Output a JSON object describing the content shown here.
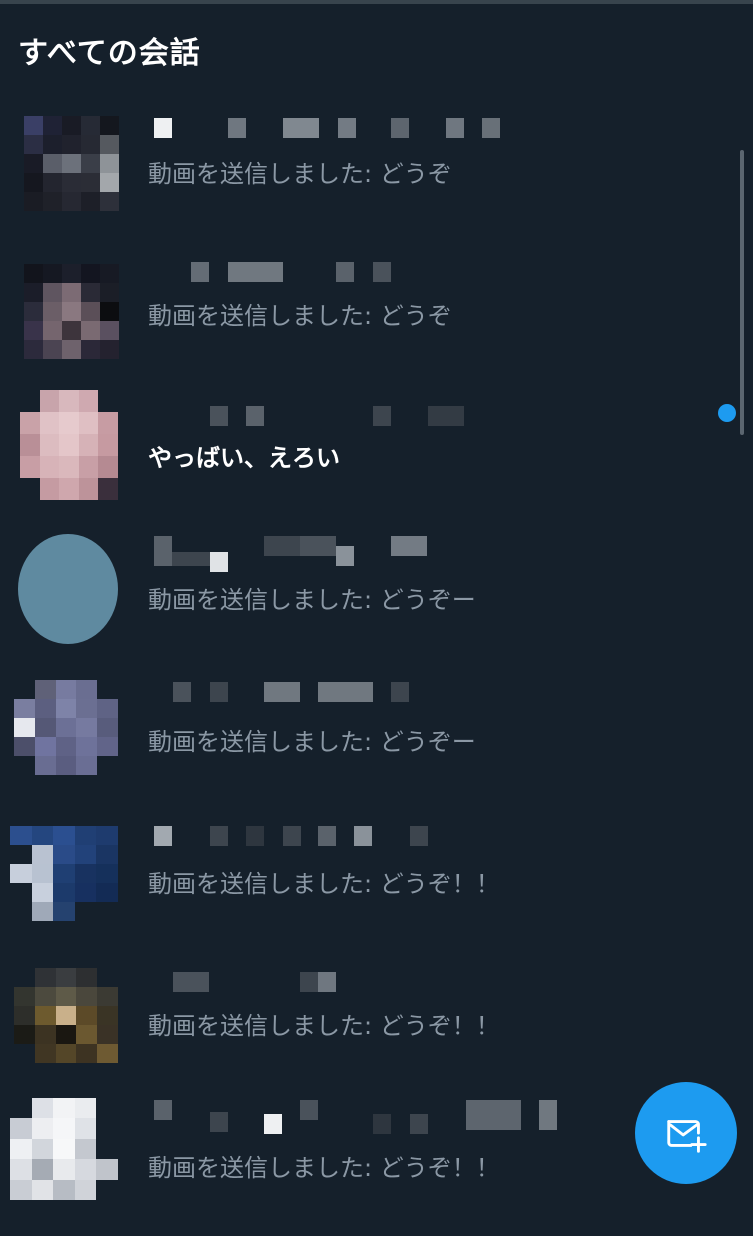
{
  "header": {
    "title": "すべての会話"
  },
  "conversations": [
    {
      "preview": "動画を送信しました: どうぞ",
      "unread": false
    },
    {
      "preview": "動画を送信しました: どうぞ",
      "unread": false
    },
    {
      "preview": "やっばい、えろい",
      "unread": true
    },
    {
      "preview": "動画を送信しました: どうぞー",
      "unread": false
    },
    {
      "preview": "動画を送信しました: どうぞー",
      "unread": false
    },
    {
      "preview": "動画を送信しました: どうぞ！！",
      "unread": false
    },
    {
      "preview": "動画を送信しました: どうぞ！！",
      "unread": false
    },
    {
      "preview": "動画を送信しました: どうぞ！！",
      "unread": false
    }
  ],
  "icons": {
    "fab": "new-message-envelope-plus-icon",
    "unread": "unread-dot-icon"
  },
  "colors": {
    "background": "#15202b",
    "accent": "#1d9bf0",
    "text_primary": "#ffffff",
    "text_secondary": "#8b98a5"
  }
}
